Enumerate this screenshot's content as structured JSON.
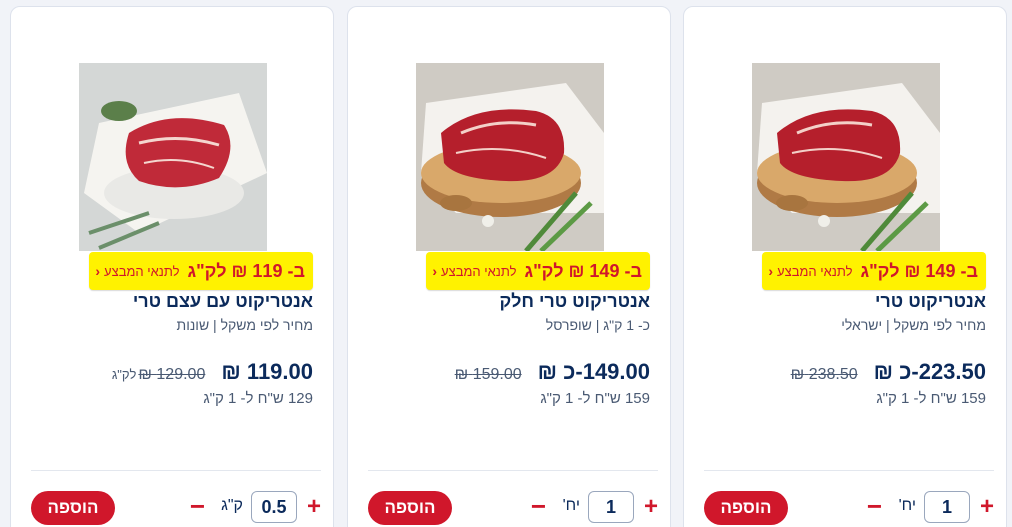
{
  "currency_symbol": "₪",
  "products": [
    {
      "image_alt": "entrecote-fresh",
      "promo_price": "ב- 149 ₪ לק\"ג",
      "promo_link": "לתנאי המבצע",
      "title": "אנטריקוט טרי",
      "meta": "מחיר לפי משקל | ישראלי",
      "price": "223.50-כ",
      "price_currency": "₪",
      "old_price": "238.50",
      "old_currency": "₪",
      "unit_note": "",
      "per_unit": "159 ש\"ח ל- 1 ק\"ג",
      "plus": "+",
      "qty": "1",
      "unit": "יח'",
      "minus": "−",
      "add_label": "הוספה"
    },
    {
      "image_alt": "entrecote-fresh-smooth",
      "promo_price": "ב- 149 ₪ לק\"ג",
      "promo_link": "לתנאי המבצע",
      "title": "אנטריקוט טרי חלק",
      "meta": "כ- 1 ק\"ג | שופרסל",
      "price": "149.00-כ",
      "price_currency": "₪",
      "old_price": "159.00",
      "old_currency": "₪",
      "unit_note": "",
      "per_unit": "159 ש\"ח ל- 1 ק\"ג",
      "plus": "+",
      "qty": "1",
      "unit": "יח'",
      "minus": "−",
      "add_label": "הוספה"
    },
    {
      "image_alt": "entrecote-on-bone",
      "promo_price": "ב- 119 ₪ לק\"ג",
      "promo_link": "לתנאי המבצע",
      "title": "אנטריקוט עם עצם טרי",
      "meta": "מחיר לפי משקל | שונות",
      "price": "119.00",
      "price_currency": "₪",
      "old_price": "129.00",
      "old_currency": "₪",
      "unit_note": "לק\"ג",
      "per_unit": "129 ש\"ח ל- 1 ק\"ג",
      "plus": "+",
      "qty": "0.5",
      "unit": "ק\"ג",
      "minus": "−",
      "add_label": "הוספה"
    }
  ]
}
